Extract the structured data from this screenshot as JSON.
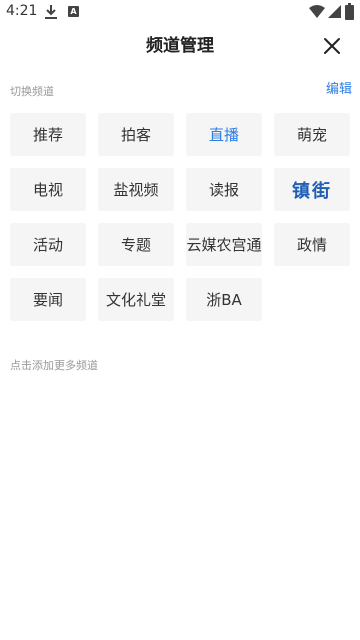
{
  "status": {
    "time": "4:21",
    "a_badge": "A"
  },
  "header": {
    "title": "频道管理"
  },
  "section": {
    "label": "切换频道",
    "edit_label": "编辑"
  },
  "channels": [
    {
      "label": "推荐"
    },
    {
      "label": "拍客"
    },
    {
      "label": "直播",
      "active": true
    },
    {
      "label": "萌宠"
    },
    {
      "label": "电视"
    },
    {
      "label": "盐视频"
    },
    {
      "label": "读报"
    },
    {
      "label": "镇街",
      "logo": true
    },
    {
      "label": "活动"
    },
    {
      "label": "专题"
    },
    {
      "label": "云媒农宫通"
    },
    {
      "label": "政情"
    },
    {
      "label": "要闻"
    },
    {
      "label": "文化礼堂"
    },
    {
      "label": "浙BA"
    }
  ],
  "add_hint": "点击添加更多频道",
  "colors": {
    "accent": "#2f7de1",
    "tile_bg": "#f5f5f5",
    "logo": "#1f5fb4"
  }
}
